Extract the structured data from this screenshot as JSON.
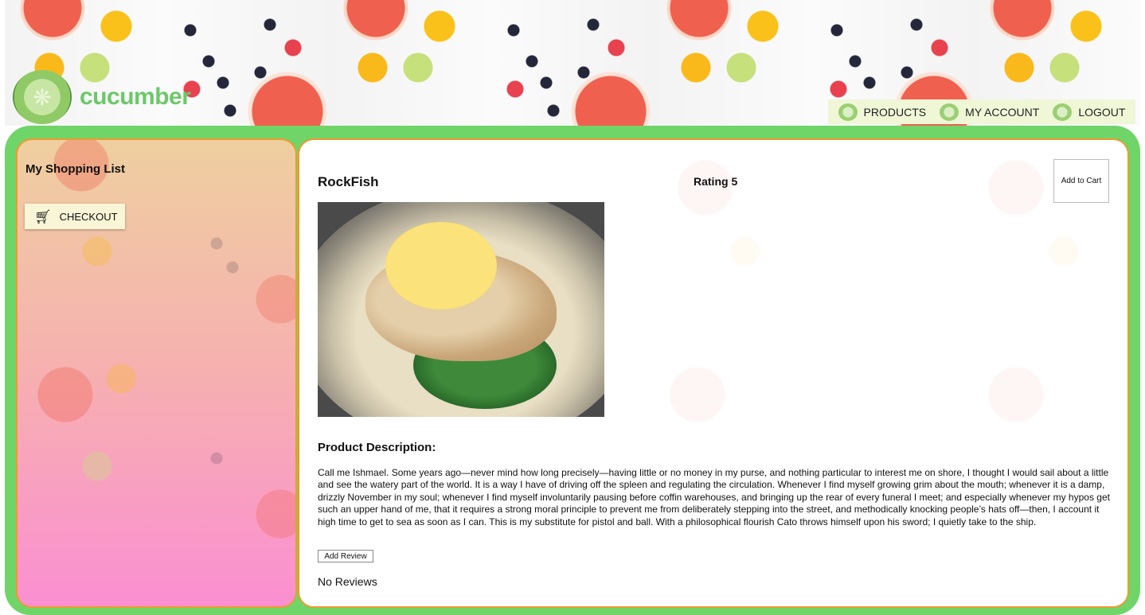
{
  "brand": {
    "name": "cucumber",
    "logo_icon": "cucumber-slice-icon"
  },
  "nav": {
    "items": [
      {
        "label": "PRODUCTS",
        "icon": "cucumber-slice-icon"
      },
      {
        "label": "MY ACCOUNT",
        "icon": "cucumber-slice-icon"
      },
      {
        "label": "LOGOUT",
        "icon": "cucumber-slice-icon"
      }
    ]
  },
  "sidebar": {
    "title": "My Shopping List",
    "checkout": {
      "label": "CHECKOUT",
      "icon": "shopping-cart-icon"
    }
  },
  "product": {
    "name": "RockFish",
    "rating": "Rating 5",
    "add_to_cart_label": "Add to Cart",
    "description_heading": "Product Description:",
    "description": "Call me Ishmael. Some years ago—never mind how long precisely—having little or no money in my purse, and nothing particular to interest me on shore, I thought I would sail about a little and see the watery part of the world. It is a way I have of driving off the spleen and regulating the circulation. Whenever I find myself growing grim about the mouth; whenever it is a damp, drizzly November in my soul; whenever I find myself involuntarily pausing before coffin warehouses, and bringing up the rear of every funeral I meet; and especially whenever my hypos get such an upper hand of me, that it requires a strong moral principle to prevent me from deliberately stepping into the street, and methodically knocking people’s hats off—then, I account it high time to get to sea as soon as I can. This is my substitute for pistol and ball. With a philosophical flourish Cato throws himself upon his sword; I quietly take to the ship.",
    "add_review_label": "Add Review",
    "reviews_status": "No Reviews"
  },
  "colors": {
    "frame_green": "#6fd568",
    "panel_border": "#f09a30",
    "brand_text": "#6cc86a",
    "nav_bg": "#eff7d6",
    "checkout_bg": "#f9f6d7"
  }
}
